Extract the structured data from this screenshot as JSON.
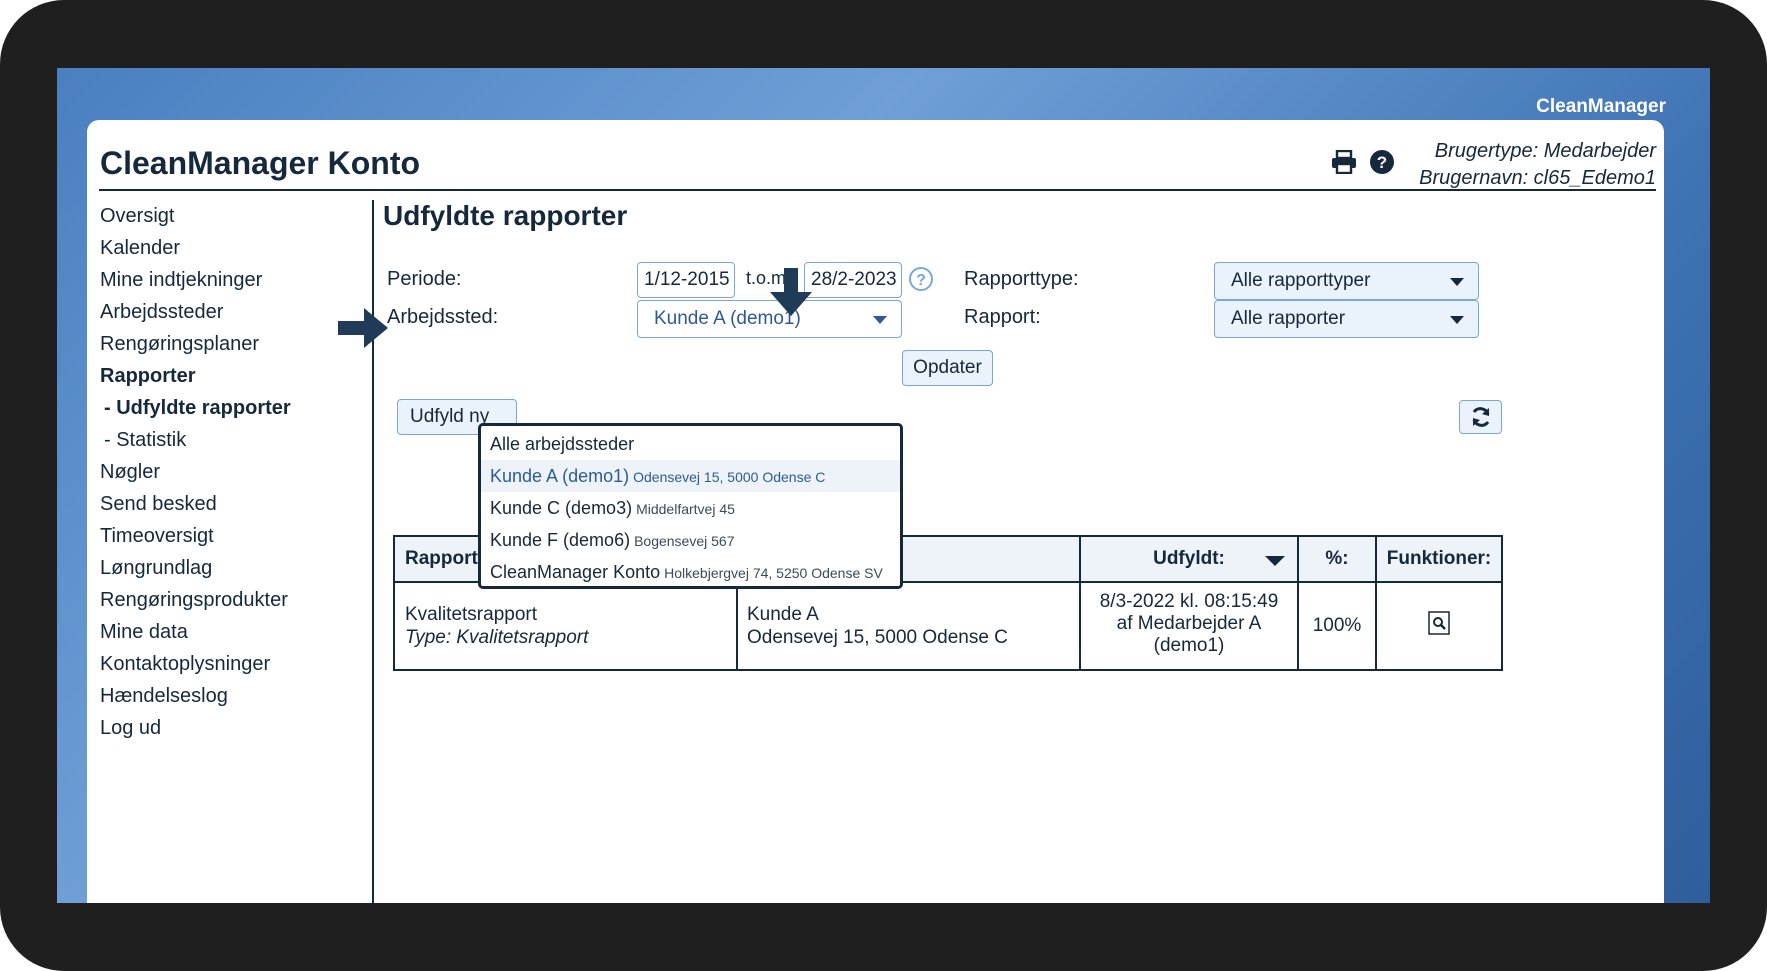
{
  "brand": "CleanManager",
  "header": {
    "title": "CleanManager Konto",
    "user_type": "Brugertype: Medarbejder",
    "user_name": "Brugernavn: cl65_Edemo1"
  },
  "sidebar": {
    "items": [
      {
        "label": "Oversigt"
      },
      {
        "label": "Kalender"
      },
      {
        "label": "Mine indtjekninger"
      },
      {
        "label": "Arbejdssteder"
      },
      {
        "label": "Rengøringsplaner"
      },
      {
        "label": "Rapporter"
      },
      {
        "label": "- Udfyldte rapporter"
      },
      {
        "label": "- Statistik"
      },
      {
        "label": "Nøgler"
      },
      {
        "label": "Send besked"
      },
      {
        "label": "Timeoversigt"
      },
      {
        "label": "Løngrundlag"
      },
      {
        "label": "Rengøringsprodukter"
      },
      {
        "label": "Mine data"
      },
      {
        "label": "Kontaktoplysninger"
      },
      {
        "label": "Hændelseslog"
      },
      {
        "label": "Log ud"
      }
    ]
  },
  "main": {
    "title": "Udfyldte rapporter",
    "filters": {
      "periode_label": "Periode:",
      "date_from": "1/12-2015",
      "date_sep": "t.o.m.",
      "date_to": "28/2-2023",
      "arbejdssted_label": "Arbejdssted:",
      "arbejdssted_value": "Kunde A (demo1)",
      "rapporttype_label": "Rapporttype:",
      "rapporttype_value": "Alle rapporttyper",
      "rapport_label": "Rapport:",
      "rapport_value": "Alle rapporter",
      "update_button": "Opdater",
      "fill_new_button": "Udfyld ny"
    },
    "dropdown": [
      {
        "name": "Alle arbejdssteder",
        "address": ""
      },
      {
        "name": "Kunde A (demo1)",
        "address": "Odensevej 15, 5000 Odense C"
      },
      {
        "name": "Kunde C (demo3)",
        "address": "Middelfartvej 45"
      },
      {
        "name": "Kunde F (demo6)",
        "address": "Bogensevej 567"
      },
      {
        "name": "CleanManager Konto",
        "address": "Holkebjergvej 74, 5250 Odense SV"
      }
    ],
    "table": {
      "headers": [
        "Rapport",
        "",
        "Udfyldt:",
        "%:",
        "Funktioner:"
      ],
      "rows": [
        {
          "report": "Kvalitetsrapport",
          "report_type": "Type: Kvalitetsrapport",
          "location": "Kunde A",
          "address": "Odensevej 15, 5000 Odense C",
          "filled_date": "8/3-2022 kl. 08:15:49",
          "filled_by": "af Medarbejder A",
          "filled_by_id": "(demo1)",
          "percent": "100%"
        }
      ]
    }
  },
  "colors": {
    "navy": "#16283b",
    "accent_blue": "#2d5a96",
    "input_border": "#7aa8d6"
  },
  "icons": [
    "print-icon",
    "help-icon",
    "help-circle-icon",
    "refresh-icon",
    "magnifier-icon",
    "arrow-right-icon",
    "arrow-down-icon"
  ]
}
